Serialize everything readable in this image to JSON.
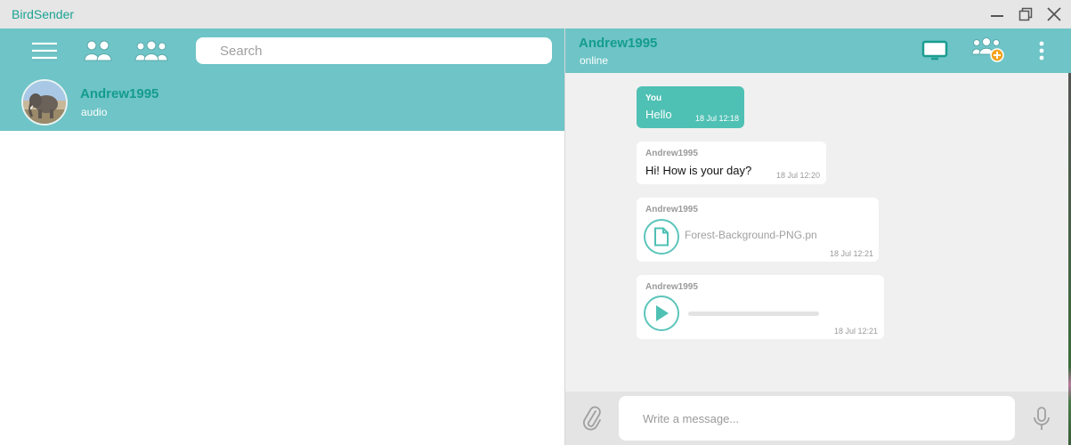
{
  "app": {
    "title": "BirdSender"
  },
  "window_controls": {
    "minimize_icon": "minimize-icon",
    "maximize_icon": "restore-icon",
    "close_icon": "close-icon"
  },
  "sidebar_toolbar": {
    "icons": [
      "menu-icon",
      "contacts-icon",
      "group-icon"
    ],
    "search_placeholder": "Search"
  },
  "contacts": [
    {
      "name": "Andrew1995",
      "last_message": "audio",
      "avatar": "elephant-photo"
    }
  ],
  "chat": {
    "contact_name": "Andrew1995",
    "status": "online",
    "header_icons": [
      "screen-share-icon",
      "add-to-group-icon",
      "more-vertical-icon"
    ],
    "messages": [
      {
        "sender": "You",
        "type": "text",
        "text": "Hello",
        "time": "18 Jul 12:18",
        "mine": true
      },
      {
        "sender": "Andrew1995",
        "type": "text",
        "text": "Hi! How is your day?",
        "time": "18 Jul 12:20",
        "mine": false
      },
      {
        "sender": "Andrew1995",
        "type": "file",
        "file_name": "Forest-Background-PNG.pn",
        "time": "18 Jul 12:21",
        "mine": false
      },
      {
        "sender": "Andrew1995",
        "type": "audio",
        "time": "18 Jul 12:21",
        "mine": false,
        "progress": 0
      }
    ],
    "compose_placeholder": "Write a message...",
    "compose_icons": [
      "paperclip-icon",
      "microphone-icon"
    ]
  },
  "colors": {
    "accent": "#6ec4c6",
    "accent_dark": "#149c8f",
    "bubble_mine": "#4fc0b4",
    "chat_bg": "#f0f0f0"
  }
}
